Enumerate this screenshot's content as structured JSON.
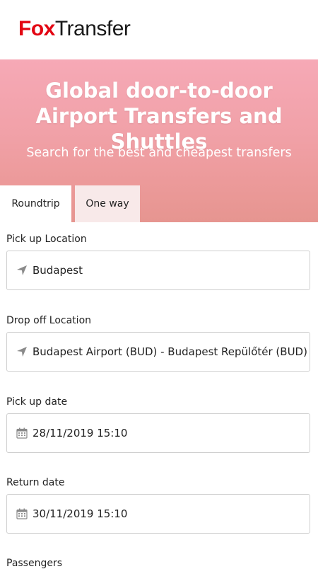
{
  "brand": {
    "part1": "Fox",
    "part2": "Transfer",
    "accent_color": "#e30613"
  },
  "hero": {
    "title": "Global door-to-door Airport Transfers and Shuttles",
    "subtitle": "Search for the best and cheapest transfers"
  },
  "tabs": [
    {
      "label": "Roundtrip",
      "active": true
    },
    {
      "label": "One way",
      "active": false
    }
  ],
  "form": {
    "pickup": {
      "label": "Pick up Location",
      "value": "Budapest",
      "icon": "location-arrow-icon"
    },
    "dropoff": {
      "label": "Drop off Location",
      "value": "Budapest Airport (BUD) - Budapest Repülőtér (BUD)",
      "icon": "location-arrow-icon"
    },
    "pickup_date": {
      "label": "Pick up date",
      "value": "28/11/2019 15:10",
      "icon": "calendar-icon"
    },
    "return_date": {
      "label": "Return date",
      "value": "30/11/2019 15:10",
      "icon": "calendar-icon"
    },
    "passengers": {
      "label": "Passengers"
    }
  }
}
